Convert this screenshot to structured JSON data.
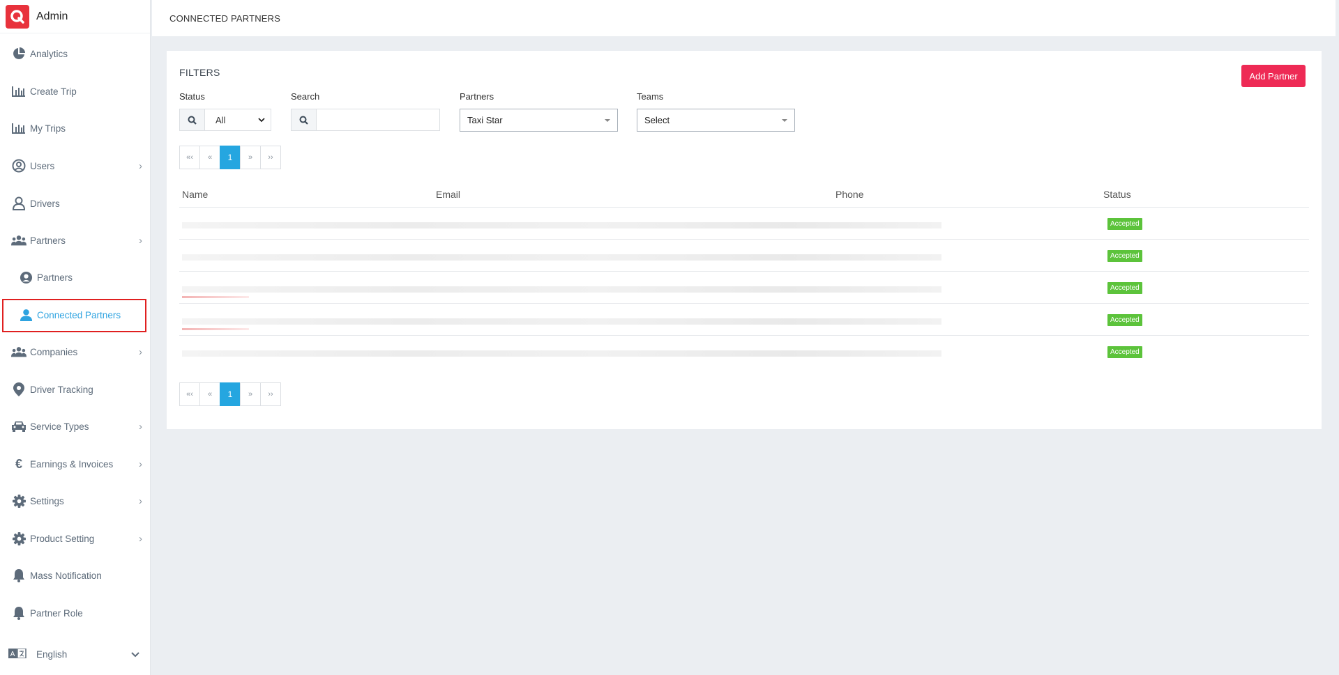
{
  "app": {
    "title": "Admin"
  },
  "sidebar": {
    "items": [
      {
        "label": "Analytics",
        "icon": "pie-chart-icon"
      },
      {
        "label": "Create Trip",
        "icon": "bar-chart-icon"
      },
      {
        "label": "My Trips",
        "icon": "bar-chart-icon"
      },
      {
        "label": "Users",
        "icon": "user-circle-icon"
      },
      {
        "label": "Drivers",
        "icon": "user-icon"
      },
      {
        "label": "Partners",
        "icon": "users-icon"
      },
      {
        "label": "Partners",
        "icon": "user-circle-icon"
      },
      {
        "label": "Connected Partners",
        "icon": "user-icon"
      },
      {
        "label": "Companies",
        "icon": "users-icon"
      },
      {
        "label": "Driver Tracking",
        "icon": "map-pin-icon"
      },
      {
        "label": "Service Types",
        "icon": "car-icon"
      },
      {
        "label": "Earnings & Invoices",
        "icon": "euro-icon"
      },
      {
        "label": "Settings",
        "icon": "gear-icon"
      },
      {
        "label": "Product Setting",
        "icon": "gear-icon"
      },
      {
        "label": "Mass Notification",
        "icon": "bell-icon"
      },
      {
        "label": "Partner Role",
        "icon": "bell-icon"
      }
    ],
    "language": {
      "label": "English",
      "icon": "translate-icon"
    }
  },
  "header": {
    "title": "CONNECTED PARTNERS"
  },
  "filters": {
    "title": "FILTERS",
    "status": {
      "label": "Status",
      "value": "All"
    },
    "search": {
      "label": "Search",
      "value": ""
    },
    "partners": {
      "label": "Partners",
      "value": "Taxi Star"
    },
    "teams": {
      "label": "Teams",
      "value": "Select"
    }
  },
  "actions": {
    "add_partner": "Add Partner"
  },
  "pagination": {
    "first": "«‹",
    "prev": "«",
    "current": "1",
    "next": "»",
    "last": "››"
  },
  "table": {
    "columns": [
      "Name",
      "Email",
      "Phone",
      "Status"
    ],
    "rows": [
      {
        "status": "Accepted"
      },
      {
        "status": "Accepted"
      },
      {
        "status": "Accepted"
      },
      {
        "status": "Accepted"
      },
      {
        "status": "Accepted"
      }
    ]
  },
  "colors": {
    "accent": "#25a6e0",
    "danger": "#ee2a55",
    "success": "#5cc33b",
    "brand": "#e8323c"
  }
}
